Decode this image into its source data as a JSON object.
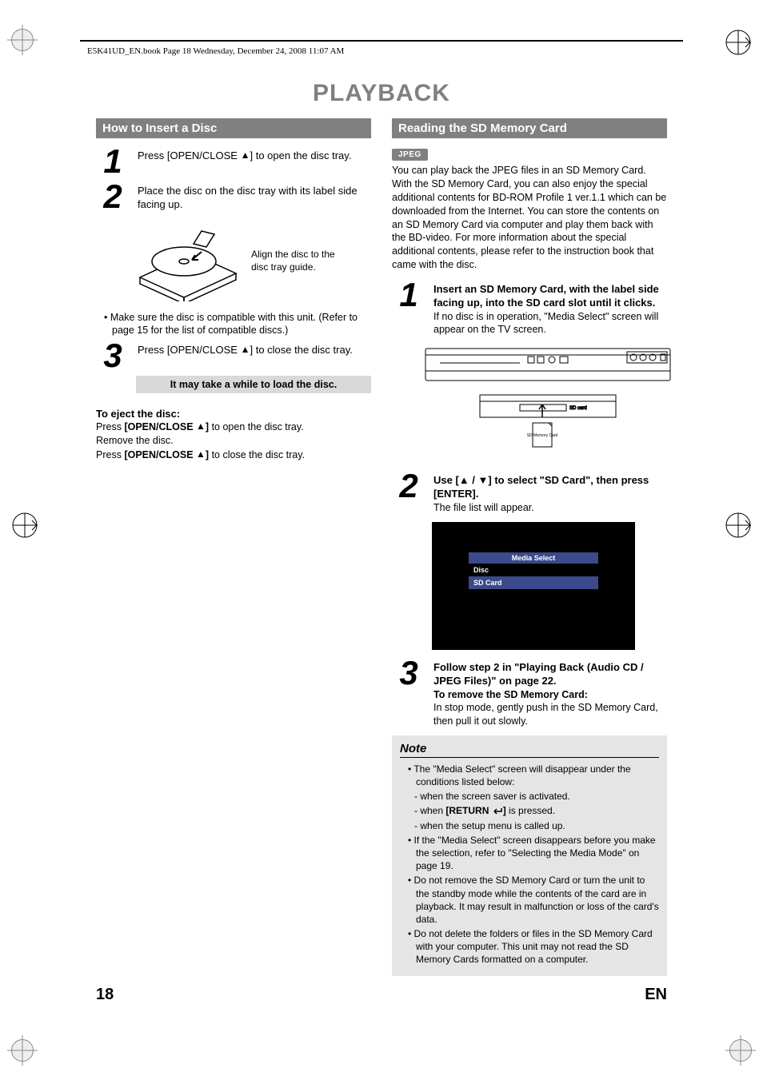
{
  "header_line": "E5K41UD_EN.book  Page 18  Wednesday, December 24, 2008  11:07 AM",
  "page_title": "PLAYBACK",
  "left": {
    "section": "How to Insert a Disc",
    "step1_num": "1",
    "step1": "Press [OPEN/CLOSE ",
    "step1_tail": "] to open the disc tray.",
    "step2_num": "2",
    "step2": "Place the disc on the disc tray with its label side facing up.",
    "fig_caption": "Align the disc to the disc tray guide.",
    "bullet1": "• Make sure the disc is compatible with this unit. (Refer to page 15 for the list of compatible discs.)",
    "step3_num": "3",
    "step3": "Press [OPEN/CLOSE ",
    "step3_tail": "] to close the disc tray.",
    "grey_note": "It may take a while to load the disc.",
    "eject_head": "To eject the disc:",
    "eject_l1a": "Press ",
    "eject_l1b": "[OPEN/CLOSE ",
    "eject_l1c": "]",
    "eject_l1d": " to open the disc tray.",
    "eject_l2": "Remove the disc.",
    "eject_l3a": "Press ",
    "eject_l3b": "[OPEN/CLOSE ",
    "eject_l3c": "]",
    "eject_l3d": " to close the disc tray."
  },
  "right": {
    "section": "Reading the SD Memory Card",
    "jpeg_badge": "JPEG",
    "intro": "You can play back the JPEG files in an SD Memory Card. With the SD Memory Card, you can also enjoy the special additional contents for BD-ROM Profile 1 ver.1.1 which can be downloaded from the Internet. You can store the contents on an SD Memory Card via computer and play them back with the BD-video. For more information about the special additional contents, please refer to the instruction book that came with the disc.",
    "step1_num": "1",
    "step1": "Insert an SD Memory Card, with the label side facing up, into the SD card slot until it clicks.",
    "step1_sub": "If no disc is in operation, \"Media Select\" screen will appear on the TV screen.",
    "sd_label": "SD Memory Card",
    "step2_num": "2",
    "step2a": "Use [",
    "step2b": " / ",
    "step2c": "] to select \"SD Card\", then press [ENTER].",
    "step2_sub": "The file list will appear.",
    "media_title": "Media Select",
    "media_opt1": "Disc",
    "media_opt2": "SD Card",
    "step3_num": "3",
    "step3": "Follow step 2 in \"Playing Back (Audio CD / JPEG Files)\" on page 22.",
    "step3_sub_head": "To remove the SD Memory Card:",
    "step3_sub": " In stop mode, gently push in the SD Memory Card, then pull it out slowly."
  },
  "note": {
    "title": "Note",
    "n1": "• The \"Media Select\" screen will disappear under the conditions listed below:",
    "n1a": "- when the screen saver is activated.",
    "n1b_a": "- when ",
    "n1b_b": "[RETURN ",
    "n1b_c": "]",
    "n1b_d": " is pressed.",
    "n1c": "- when the setup menu is called up.",
    "n2": "• If the \"Media Select\" screen disappears before you make the selection, refer to \"Selecting the Media Mode\" on page 19.",
    "n3": "• Do not remove the SD Memory Card or turn the unit to the standby mode while the contents of the card are in playback. It may result in malfunction or loss of the card's data.",
    "n4": "• Do not delete the folders or files in the SD Memory Card with your computer. This unit may not read the SD Memory Cards formatted on a computer."
  },
  "footer": {
    "page": "18",
    "lang": "EN"
  }
}
